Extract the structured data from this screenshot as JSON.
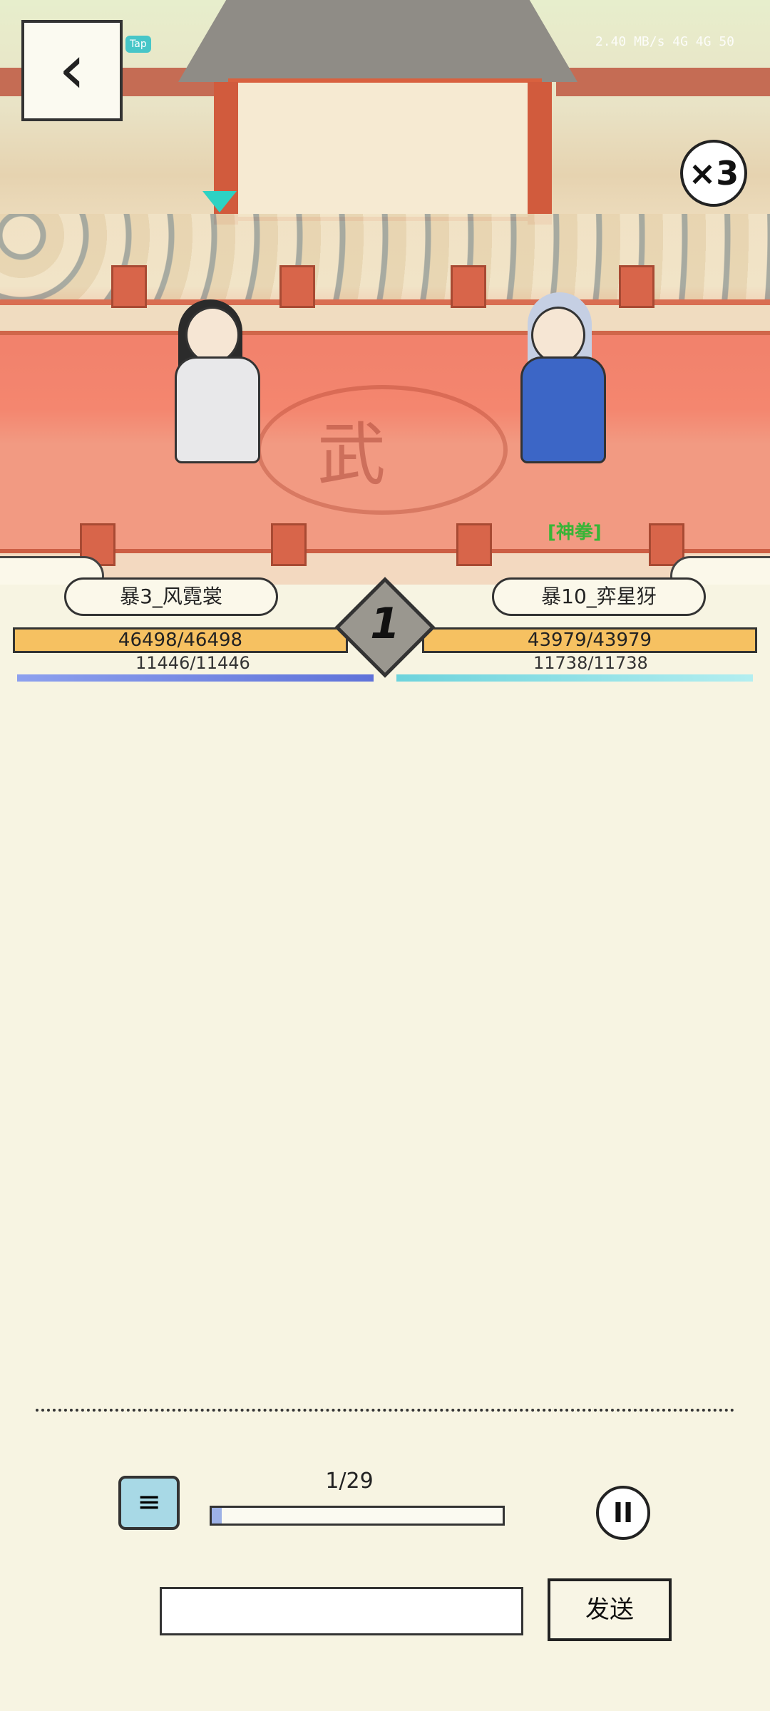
{
  "arena": {
    "floor_emblem": "武",
    "speed_label": "×3",
    "skill_tag": "[神拳]",
    "round": "1"
  },
  "status": {
    "tap_label": "Tap",
    "net_speed": "2.40 MB/s",
    "signal": "4G 4G",
    "battery": "50"
  },
  "fighters": {
    "left": {
      "name": "暴3_风霓裳",
      "hp": "46498/46498",
      "hp_fraction": 1.0,
      "mp": "11446/11446",
      "color": "#f6c161"
    },
    "right": {
      "name": "暴10_弈星犽",
      "hp": "43979/43979",
      "hp_fraction": 1.0,
      "mp": "11738/11738",
      "color": "#f6c161"
    }
  },
  "bottom": {
    "progress_label": "1/29",
    "progress_fraction": 0.0345,
    "send_label": "发送",
    "input_placeholder": "",
    "pause_icon": "pause-icon",
    "log_icon": "chat-log-icon"
  },
  "colors": {
    "hp": "#f6c161",
    "mp_left": "#6b7fe0",
    "mp_right": "#8fe0e6",
    "floor": "#f4866f"
  }
}
